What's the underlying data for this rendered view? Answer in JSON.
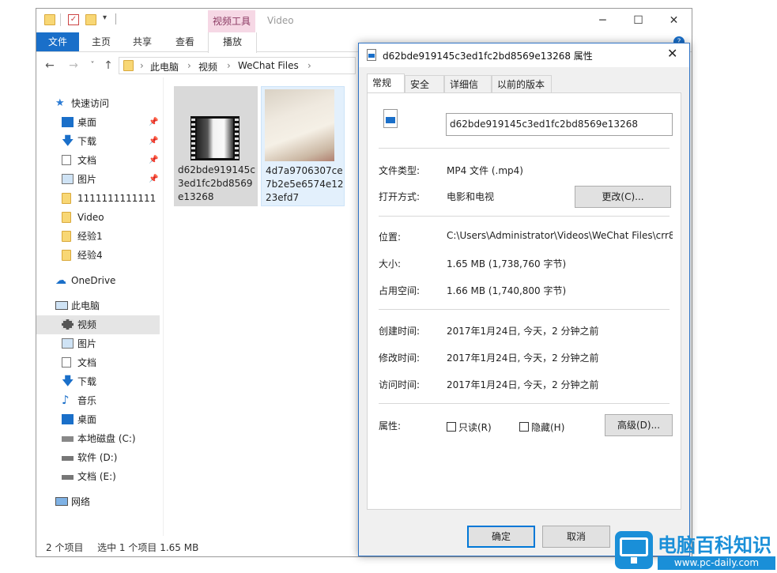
{
  "explorer": {
    "title": "Video",
    "tool_tab": "视频工具",
    "ribbon_tabs": {
      "file": "文件",
      "home": "主页",
      "share": "共享",
      "view": "查看",
      "play": "播放"
    },
    "breadcrumb": [
      "此电脑",
      "视频",
      "WeChat Files"
    ],
    "sidebar": {
      "quick_access": "快速访问",
      "items": [
        {
          "label": "桌面"
        },
        {
          "label": "下载"
        },
        {
          "label": "文档"
        },
        {
          "label": "图片"
        },
        {
          "label": "1111111111111"
        },
        {
          "label": "Video"
        },
        {
          "label": "经验1"
        },
        {
          "label": "经验4"
        }
      ],
      "onedrive": "OneDrive",
      "this_pc": "此电脑",
      "pc_items": [
        {
          "label": "视频"
        },
        {
          "label": "图片"
        },
        {
          "label": "文档"
        },
        {
          "label": "下载"
        },
        {
          "label": "音乐"
        },
        {
          "label": "桌面"
        },
        {
          "label": "本地磁盘 (C:)"
        },
        {
          "label": "软件 (D:)"
        },
        {
          "label": "文档 (E:)"
        }
      ],
      "network": "网络"
    },
    "files": [
      {
        "name": "d62bde919145c3ed1fc2bd8569e13268"
      },
      {
        "name": "4d7a9706307ce7b2e5e6574e1223efd7"
      }
    ],
    "status": {
      "count": "2 个项目",
      "selected": "选中 1 个项目  1.65 MB"
    }
  },
  "dialog": {
    "title": "d62bde919145c3ed1fc2bd8569e13268 属性",
    "tabs": [
      "常规",
      "安全",
      "详细信息",
      "以前的版本"
    ],
    "filename": "d62bde919145c3ed1fc2bd8569e13268",
    "labels": {
      "type": "文件类型:",
      "open_with": "打开方式:",
      "location": "位置:",
      "size": "大小:",
      "size_on_disk": "占用空间:",
      "created": "创建时间:",
      "modified": "修改时间:",
      "accessed": "访问时间:",
      "attributes": "属性:"
    },
    "values": {
      "type": "MP4 文件 (.mp4)",
      "open_with": "电影和电视",
      "location": "C:\\Users\\Administrator\\Videos\\WeChat Files\\crr8",
      "size": "1.65 MB (1,738,760 字节)",
      "size_on_disk": "1.66 MB (1,740,800 字节)",
      "created": "2017年1月24日, 今天，2 分钟之前",
      "modified": "2017年1月24日, 今天，2 分钟之前",
      "accessed": "2017年1月24日, 今天，2 分钟之前"
    },
    "buttons": {
      "change": "更改(C)...",
      "advanced": "高级(D)...",
      "ok": "确定",
      "cancel": "取消"
    },
    "checkboxes": {
      "readonly": "只读(R)",
      "hidden": "隐藏(H)"
    }
  },
  "watermark": {
    "title": "电脑百科知识",
    "url": "www.pc-daily.com"
  }
}
